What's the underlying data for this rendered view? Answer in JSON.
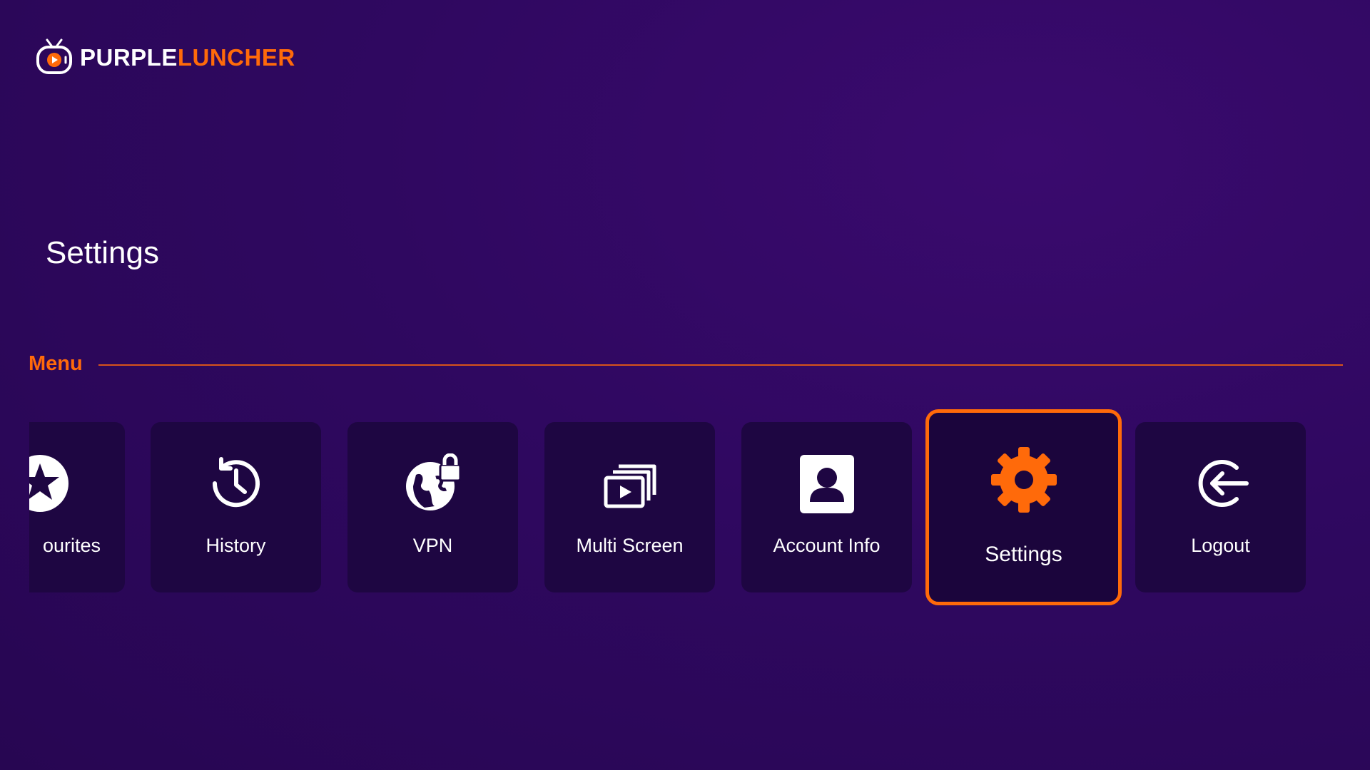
{
  "brand": {
    "part1": "PURPLE",
    "part2": "LUNCHER"
  },
  "page_title": "Settings",
  "menu": {
    "label": "Menu",
    "items": [
      {
        "label": "ourites",
        "icon": "star-icon"
      },
      {
        "label": "History",
        "icon": "history-icon"
      },
      {
        "label": "VPN",
        "icon": "vpn-globe-lock-icon"
      },
      {
        "label": "Multi Screen",
        "icon": "multi-screen-icon"
      },
      {
        "label": "Account Info",
        "icon": "account-icon"
      },
      {
        "label": "Settings",
        "icon": "gear-icon",
        "selected": true
      },
      {
        "label": "Logout",
        "icon": "logout-icon"
      }
    ]
  },
  "colors": {
    "accent": "#ff6a0a",
    "tile_bg": "#1e0642",
    "background": "#2f0860"
  }
}
